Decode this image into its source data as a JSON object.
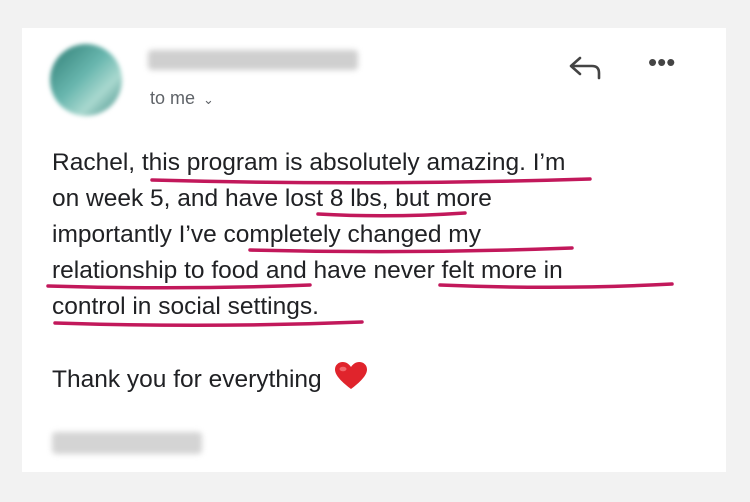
{
  "email": {
    "recipient_label": "to me",
    "body_lines": [
      "Rachel, this program is absolutely amazing. I’m",
      "on week 5, and have lost 8 lbs, but more",
      "importantly I’ve completely changed my",
      "relationship to food and have never felt more in",
      "control in social settings."
    ],
    "closing": "Thank you for everything"
  },
  "icons": {
    "reply": "reply-arrow-icon",
    "more": "more-options-icon",
    "chevron": "chevron-down-icon",
    "heart": "red-heart-emoji"
  },
  "colors": {
    "highlight": "#c2185b",
    "text": "#202124",
    "secondary_text": "#5f6368",
    "heart": "#e0242c"
  }
}
